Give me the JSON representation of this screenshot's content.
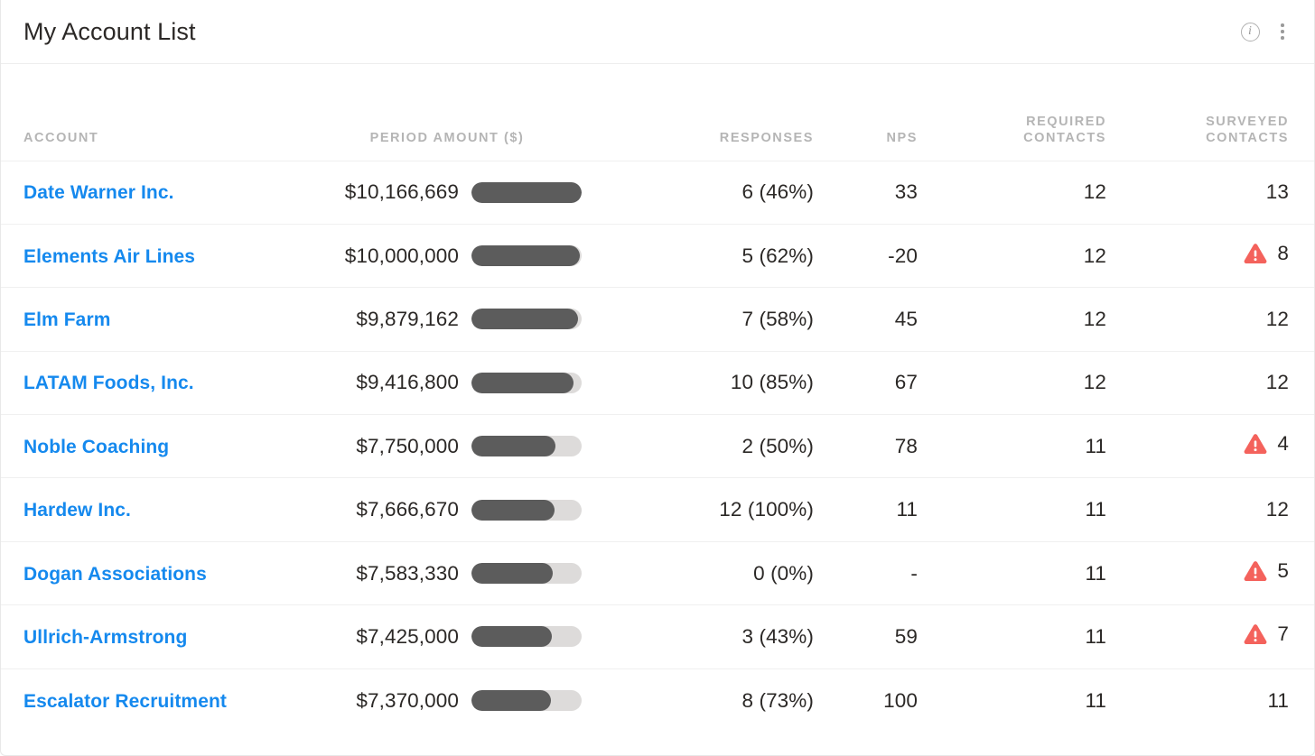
{
  "header": {
    "title": "My Account List",
    "info_icon": "info-circle-icon",
    "info_glyph": "i",
    "menu_icon": "kebab-menu-icon"
  },
  "colors": {
    "link_blue": "#1589ee",
    "warning_red": "#f4625c",
    "bar_fill": "#5c5c5c",
    "bar_track": "#dddbda",
    "header_text": "#b5b5b5",
    "body_text": "#2b2826"
  },
  "table": {
    "columns": [
      {
        "key": "account",
        "label": "ACCOUNT",
        "align": "left"
      },
      {
        "key": "amount",
        "label": "PERIOD AMOUNT ($)",
        "align": "center"
      },
      {
        "key": "responses",
        "label": "RESPONSES",
        "align": "right"
      },
      {
        "key": "nps",
        "label": "NPS",
        "align": "right"
      },
      {
        "key": "required",
        "label": "REQUIRED\nCONTACTS",
        "align": "right"
      },
      {
        "key": "surveyed",
        "label": "SURVEYED\nCONTACTS",
        "align": "right"
      }
    ],
    "rows": [
      {
        "account": "Date Warner Inc.",
        "amount_text": "$10,166,669",
        "amount_value": 10166669,
        "bar_percent": 100,
        "responses": "6 (46%)",
        "nps": "33",
        "required_contacts": "12",
        "surveyed_contacts": "13",
        "surveyed_warning": false
      },
      {
        "account": "Elements Air Lines",
        "amount_text": "$10,000,000",
        "amount_value": 10000000,
        "bar_percent": 98,
        "responses": "5 (62%)",
        "nps": "-20",
        "required_contacts": "12",
        "surveyed_contacts": "8",
        "surveyed_warning": true
      },
      {
        "account": "Elm Farm",
        "amount_text": "$9,879,162",
        "amount_value": 9879162,
        "bar_percent": 97,
        "responses": "7 (58%)",
        "nps": "45",
        "required_contacts": "12",
        "surveyed_contacts": "12",
        "surveyed_warning": false
      },
      {
        "account": "LATAM Foods, Inc.",
        "amount_text": "$9,416,800",
        "amount_value": 9416800,
        "bar_percent": 93,
        "responses": "10 (85%)",
        "nps": "67",
        "required_contacts": "12",
        "surveyed_contacts": "12",
        "surveyed_warning": false
      },
      {
        "account": "Noble Coaching",
        "amount_text": "$7,750,000",
        "amount_value": 7750000,
        "bar_percent": 76,
        "responses": "2 (50%)",
        "nps": "78",
        "required_contacts": "11",
        "surveyed_contacts": "4",
        "surveyed_warning": true
      },
      {
        "account": "Hardew Inc.",
        "amount_text": "$7,666,670",
        "amount_value": 7666670,
        "bar_percent": 75,
        "responses": "12 (100%)",
        "nps": "11",
        "required_contacts": "11",
        "surveyed_contacts": "12",
        "surveyed_warning": false
      },
      {
        "account": "Dogan Associations",
        "amount_text": "$7,583,330",
        "amount_value": 7583330,
        "bar_percent": 74,
        "responses": "0 (0%)",
        "nps": "-",
        "required_contacts": "11",
        "surveyed_contacts": "5",
        "surveyed_warning": true
      },
      {
        "account": "Ullrich-Armstrong",
        "amount_text": "$7,425,000",
        "amount_value": 7425000,
        "bar_percent": 73,
        "responses": "3 (43%)",
        "nps": "59",
        "required_contacts": "11",
        "surveyed_contacts": "7",
        "surveyed_warning": true
      },
      {
        "account": "Escalator Recruitment",
        "amount_text": "$7,370,000",
        "amount_value": 7370000,
        "bar_percent": 72,
        "responses": "8 (73%)",
        "nps": "100",
        "required_contacts": "11",
        "surveyed_contacts": "11",
        "surveyed_warning": false
      }
    ]
  }
}
